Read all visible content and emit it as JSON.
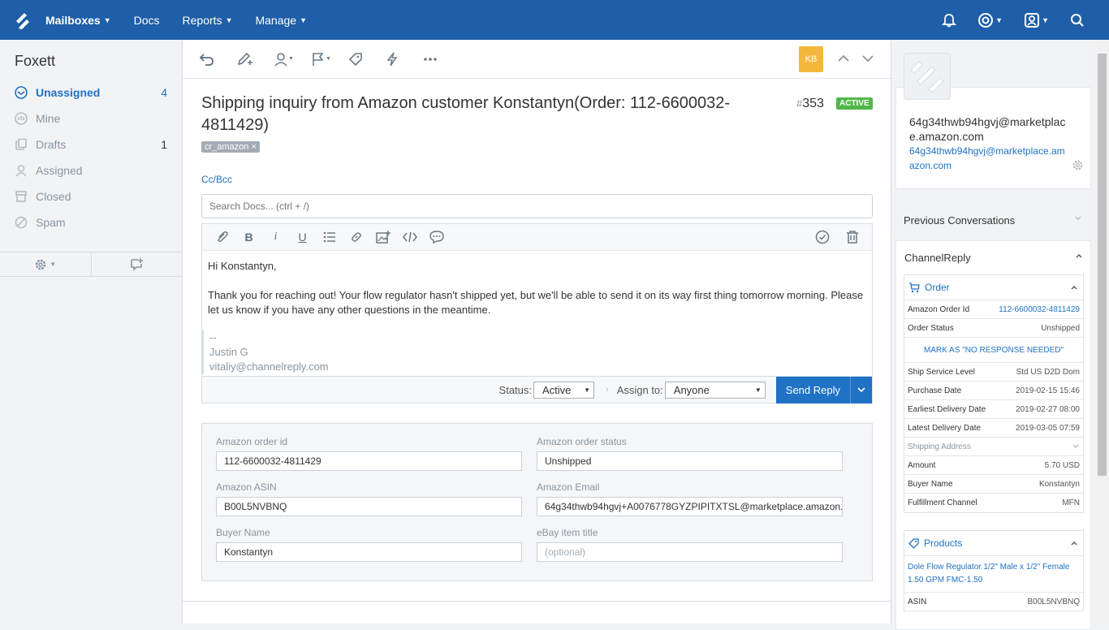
{
  "topnav": {
    "items": [
      {
        "label": "Mailboxes"
      },
      {
        "label": "Docs"
      },
      {
        "label": "Reports"
      },
      {
        "label": "Manage"
      }
    ]
  },
  "sidebar": {
    "title": "Foxett",
    "items": [
      {
        "label": "Unassigned",
        "count": "4"
      },
      {
        "label": "Mine",
        "count": ""
      },
      {
        "label": "Drafts",
        "count": "1"
      },
      {
        "label": "Assigned",
        "count": ""
      },
      {
        "label": "Closed",
        "count": ""
      },
      {
        "label": "Spam",
        "count": ""
      }
    ]
  },
  "conversation": {
    "assignee_initials": "KB",
    "subject": "Shipping inquiry from Amazon customer Konstantyn(Order: 112-6600032-4811429)",
    "hash": "#",
    "number": "353",
    "status_badge": "ACTIVE",
    "tag": "cr_amazon",
    "tag_remove": "×",
    "cc_bcc": "Cc/Bcc",
    "search_docs_placeholder": "Search Docs... (ctrl + /)"
  },
  "editor": {
    "greeting": "Hi Konstantyn,",
    "body": "Thank you for reaching out! Your flow regulator hasn't shipped yet, but we'll be able to send it on its way first thing tomorrow morning. Please let us know if you have any other questions in the meantime.",
    "sig_dashes": "--",
    "sig_name": "Justin G",
    "sig_email": "vitaliy@channelreply.com"
  },
  "reply_bar": {
    "status_label": "Status:",
    "status_value": "Active",
    "assign_label": "Assign to:",
    "assign_value": "Anyone",
    "send_label": "Send Reply"
  },
  "fields": {
    "order_id": {
      "label": "Amazon order id",
      "value": "112-6600032-4811429"
    },
    "order_status": {
      "label": "Amazon order status",
      "value": "Unshipped"
    },
    "asin": {
      "label": "Amazon ASIN",
      "value": "B00L5NVBNQ"
    },
    "email": {
      "label": "Amazon Email",
      "value": "64g34thwb94hgvj+A0076778GYZPIPITXTSL@marketplace.amazon."
    },
    "buyer": {
      "label": "Buyer Name",
      "value": "Konstantyn"
    },
    "ebay_title": {
      "label": "eBay item title",
      "placeholder": "(optional)"
    }
  },
  "customer": {
    "email_bold": "64g34thwb94hgvj@marketplace.amazon.com",
    "email_link": "64g34thwb94hgvj@marketplace.amazon.com"
  },
  "right_panel": {
    "previous_conversations": "Previous Conversations",
    "channelreply": "ChannelReply",
    "order_header": "Order",
    "order_rows": [
      {
        "k": "Amazon Order Id",
        "v": "112-6600032-4811429"
      },
      {
        "k": "Order Status",
        "v": "Unshipped"
      }
    ],
    "mark_button": "MARK AS \"NO RESPONSE NEEDED\"",
    "order_rows2": [
      {
        "k": "Ship Service Level",
        "v": "Std US D2D Dom"
      },
      {
        "k": "Purchase Date",
        "v": "2019-02-15 15:46"
      },
      {
        "k": "Earliest Delivery Date",
        "v": "2019-02-27 08:00"
      },
      {
        "k": "Latest Delivery Date",
        "v": "2019-03-05 07:59"
      }
    ],
    "shipping_address": "Shipping Address",
    "order_rows3": [
      {
        "k": "Amount",
        "v": "5.70 USD"
      },
      {
        "k": "Buyer Name",
        "v": "Konstantyn"
      },
      {
        "k": "Fulfillment Channel",
        "v": "MFN"
      }
    ],
    "products_header": "Products",
    "product_title": "Dole Flow Regulator 1/2\" Male x 1/2\" Female 1.50 GPM FMC-1.50",
    "product_rows": [
      {
        "k": "ASIN",
        "v": "B00L5NVBNQ"
      }
    ]
  },
  "colors": {
    "brand": "#1f5ea8",
    "accent": "#1f72c4",
    "active_badge": "#50b848",
    "avatar_bg": "#f5b73b"
  }
}
